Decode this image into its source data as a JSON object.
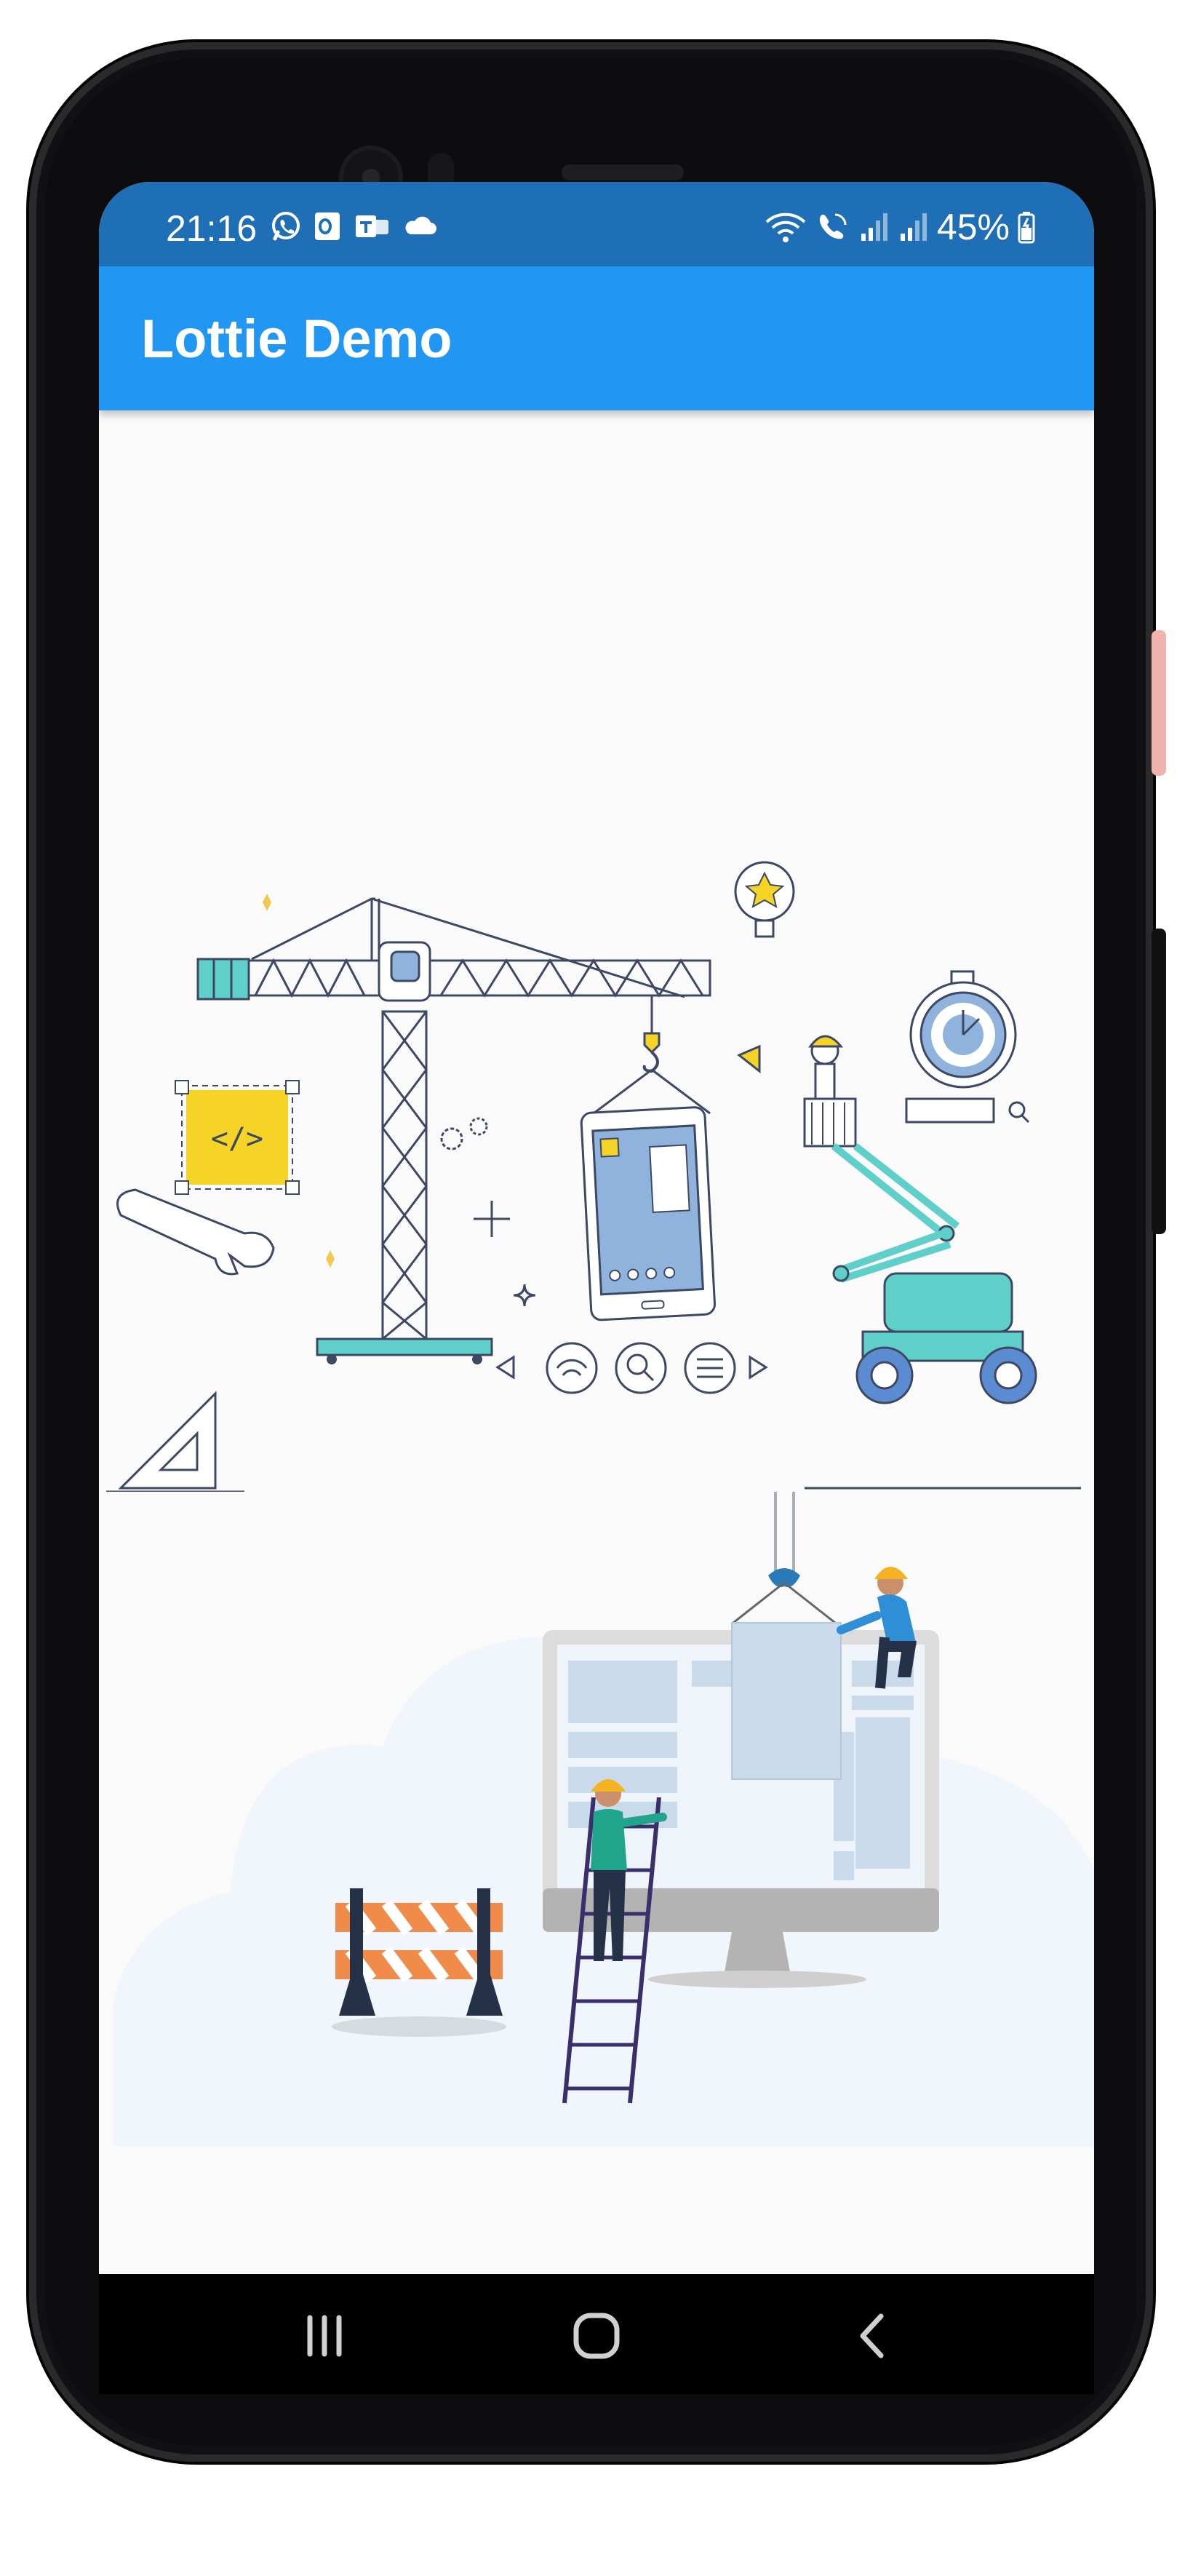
{
  "status_bar": {
    "time": "21:16",
    "battery": "45%",
    "icons_left": [
      "whatsapp-icon",
      "outlook-icon",
      "teams-icon",
      "cloud-icon"
    ],
    "icons_right": [
      "wifi-icon",
      "wifi-call-icon",
      "signal-icon",
      "signal-icon",
      "battery-icon"
    ]
  },
  "app_bar": {
    "title": "Lottie Demo",
    "color": "#2196f3",
    "status_color": "#1e6fb5"
  },
  "animations": [
    {
      "name": "construction-crane-animation"
    },
    {
      "name": "website-under-construction-animation"
    }
  ],
  "nav_bar": {
    "buttons": [
      "recent-apps-icon",
      "home-icon",
      "back-icon"
    ]
  }
}
